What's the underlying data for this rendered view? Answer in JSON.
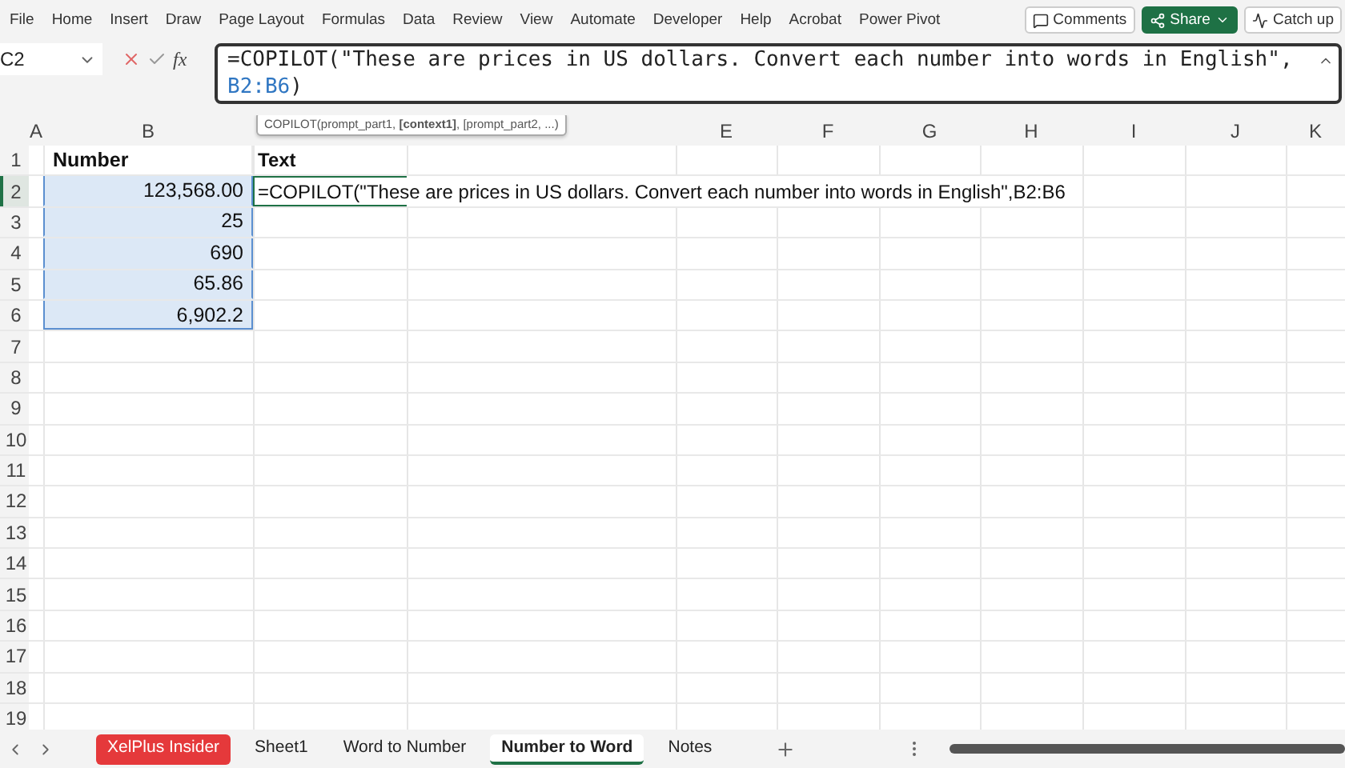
{
  "ribbon_tabs": [
    {
      "label": "File"
    },
    {
      "label": "Home"
    },
    {
      "label": "Insert"
    },
    {
      "label": "Draw"
    },
    {
      "label": "Page Layout"
    },
    {
      "label": "Formulas"
    },
    {
      "label": "Data"
    },
    {
      "label": "Review"
    },
    {
      "label": "View"
    },
    {
      "label": "Automate"
    },
    {
      "label": "Developer"
    },
    {
      "label": "Help"
    },
    {
      "label": "Acrobat"
    },
    {
      "label": "Power Pivot"
    }
  ],
  "ribbon_buttons": [
    {
      "kind": "comments",
      "label": "Comments"
    },
    {
      "kind": "share",
      "label": "Share"
    },
    {
      "kind": "catchup",
      "label": "Catch up"
    }
  ],
  "name_box": "C2",
  "function_label": "fx",
  "formula_bar": {
    "line_1": "=COPILOT(\"These are prices in US dollars. Convert each number into words in English\",",
    "reference": "B2:B6",
    "closing": ")"
  },
  "tooltip": "COPILOT(prompt_part1, **[context1]**, [prompt_part2, ...)",
  "columns": [
    {
      "label": "A"
    },
    {
      "label": "B"
    },
    {},
    {},
    {
      "label": "E"
    },
    {
      "label": "F"
    },
    {
      "label": "G"
    },
    {
      "label": "H"
    },
    {
      "label": "I"
    },
    {
      "label": "J"
    },
    {
      "label": "K"
    }
  ],
  "rows": [
    {
      "number": "1",
      "active": false,
      "b": {
        "text": "Number",
        "kind": "header",
        "selected": false
      },
      "c": {
        "text": "Text",
        "kind": "header",
        "active": false
      }
    },
    {
      "number": "2",
      "active": true,
      "b": {
        "text": "123,568.00",
        "kind": "number",
        "selected": true
      },
      "c": {
        "text": "=COPILOT(\"These are prices in US dollars. Convert each number into words in English\",B2:B6",
        "kind": "formula",
        "active": true
      }
    },
    {
      "number": "3",
      "active": false,
      "b": {
        "text": "25",
        "kind": "number",
        "selected": true
      }
    },
    {
      "number": "4",
      "active": false,
      "b": {
        "text": "690",
        "kind": "number",
        "selected": true
      }
    },
    {
      "number": "5",
      "active": false,
      "b": {
        "text": "65.86",
        "kind": "number",
        "selected": true
      }
    },
    {
      "number": "6",
      "active": false,
      "b": {
        "text": "6,902.2",
        "kind": "number",
        "selected": true
      }
    },
    {
      "number": "7",
      "active": false
    },
    {
      "number": "8",
      "active": false
    },
    {
      "number": "9",
      "active": false
    },
    {
      "number": "10",
      "active": false
    },
    {
      "number": "11",
      "active": false
    },
    {
      "number": "12",
      "active": false
    },
    {
      "number": "13",
      "active": false
    },
    {
      "number": "14",
      "active": false
    },
    {
      "number": "15",
      "active": false
    },
    {
      "number": "16",
      "active": false
    },
    {
      "number": "17",
      "active": false
    },
    {
      "number": "18",
      "active": false
    },
    {
      "number": "19",
      "active": false
    }
  ],
  "sheet_tabs": [
    {
      "label": "XelPlus Insider",
      "selected": false,
      "color": "#e5393b"
    },
    {
      "label": "Sheet1",
      "selected": false
    },
    {
      "label": "Word to Number",
      "selected": false
    },
    {
      "label": "Number to Word",
      "selected": true
    },
    {
      "label": "Notes",
      "selected": false
    }
  ]
}
